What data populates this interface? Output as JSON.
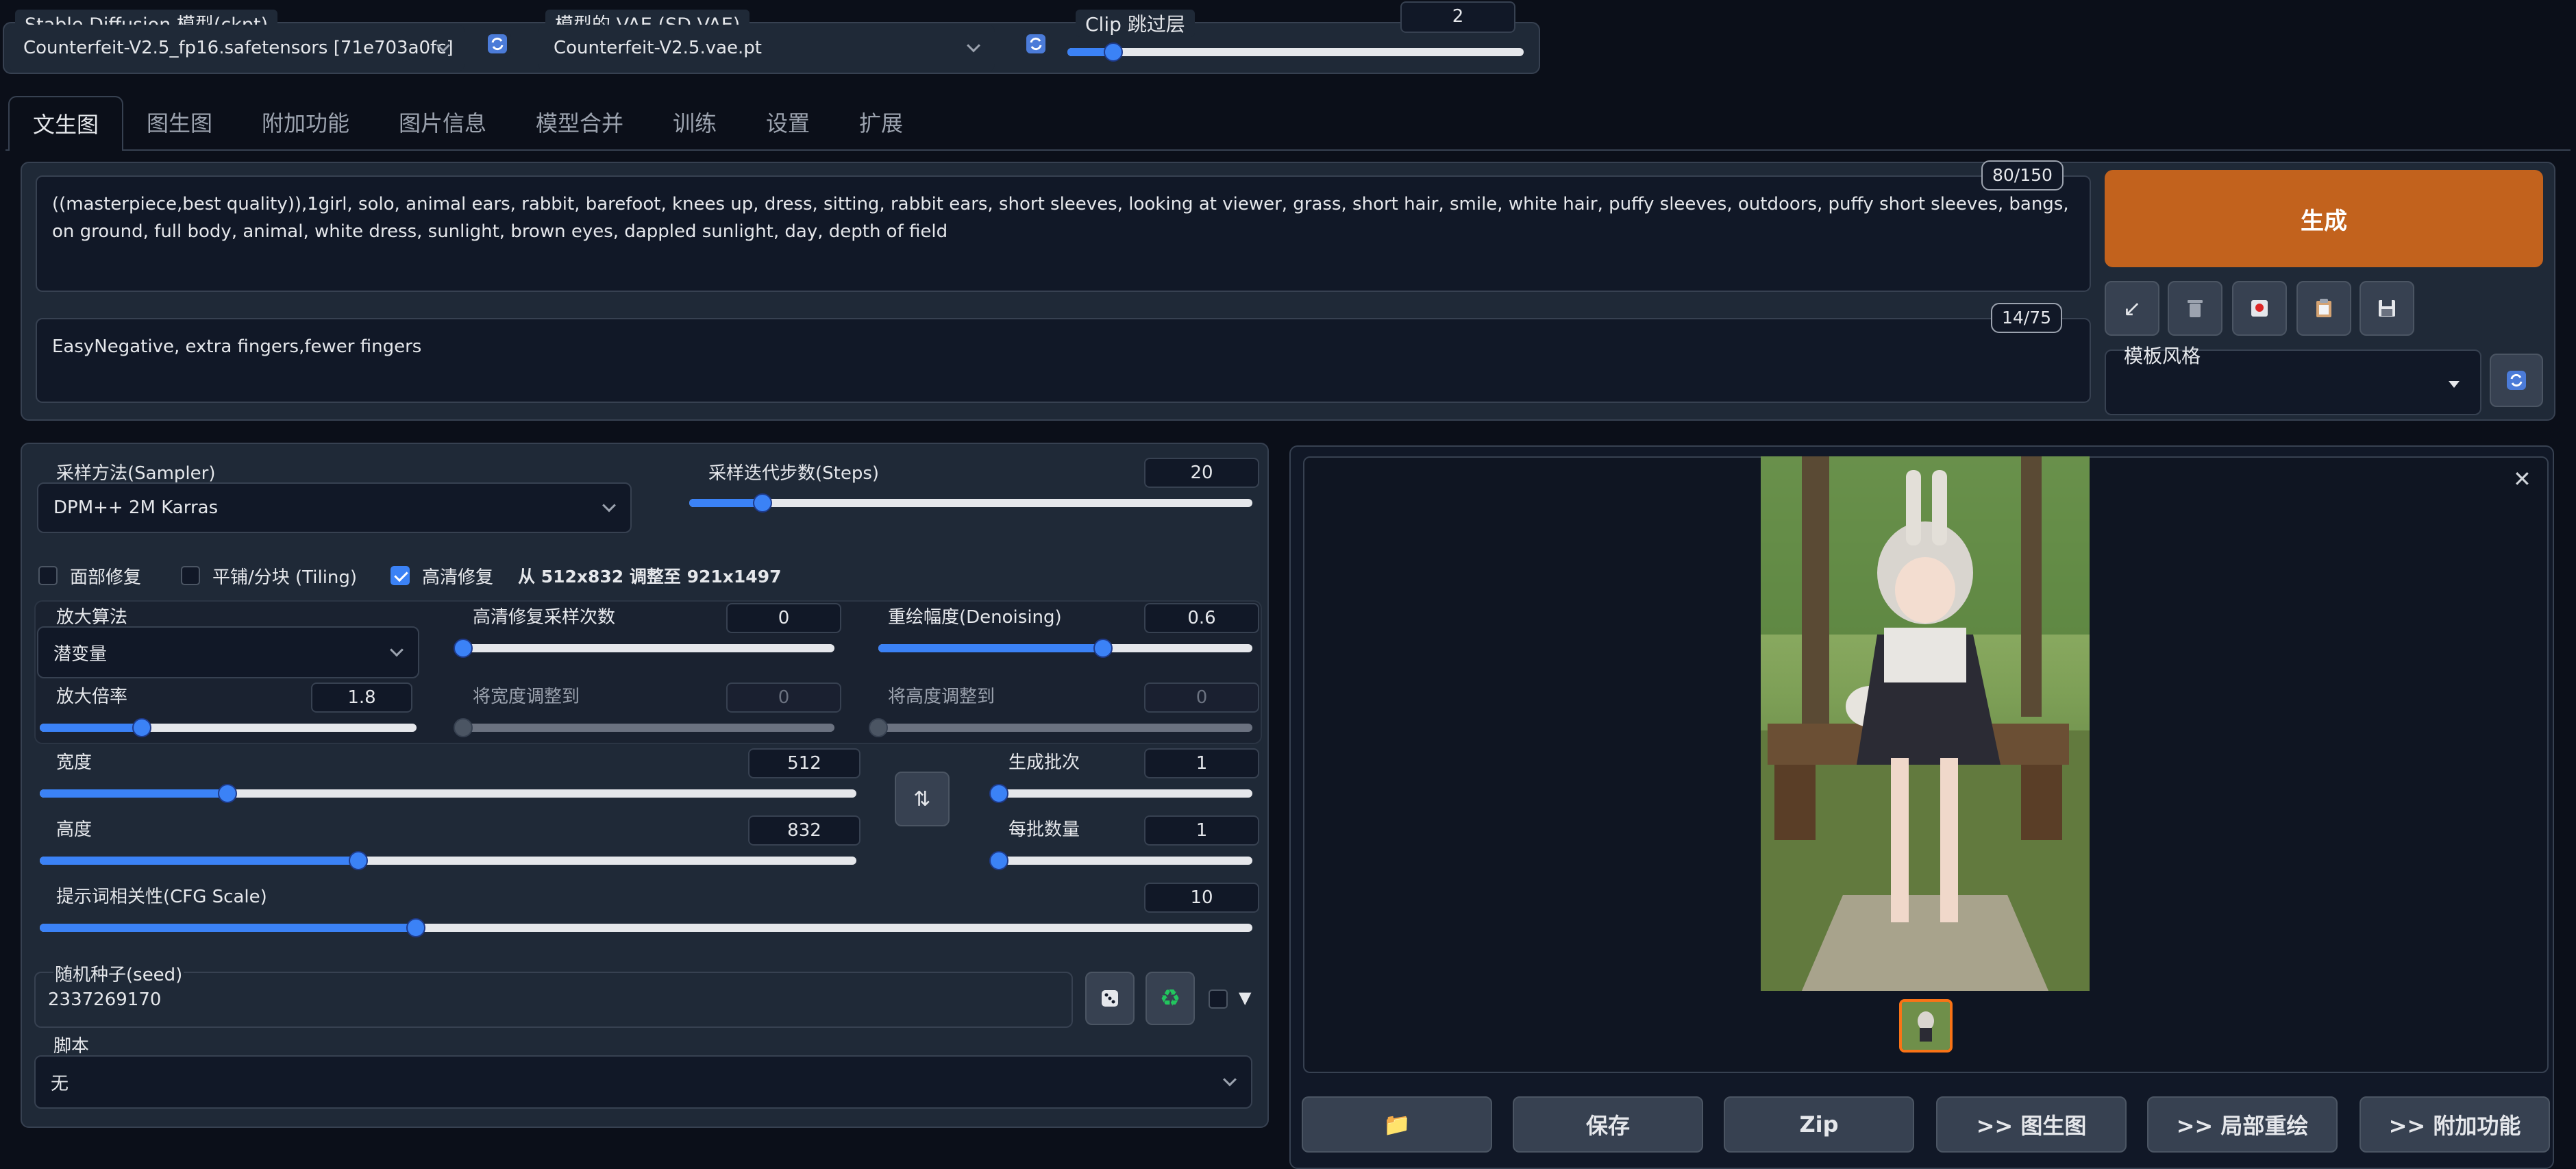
{
  "top": {
    "ckpt_label": "Stable Diffusion 模型(ckpt)",
    "ckpt_value": "Counterfeit-V2.5_fp16.safetensors [71e703a0fc]",
    "vae_label": "模型的 VAE (SD VAE)",
    "vae_value": "Counterfeit-V2.5.vae.pt",
    "clip_label": "Clip 跳过层",
    "clip_value": "2",
    "clip_level": 0.1
  },
  "tabs": [
    "文生图",
    "图生图",
    "附加功能",
    "图片信息",
    "模型合并",
    "训练",
    "设置",
    "扩展"
  ],
  "prompt": {
    "positive": "((masterpiece,best quality)),1girl, solo, animal ears, rabbit, barefoot, knees up, dress, sitting, rabbit ears, short sleeves, looking at viewer, grass, short hair, smile, white hair, puffy sleeves, outdoors, puffy short sleeves, bangs, on ground, full body, animal, white dress, sunlight, brown eyes, dappled sunlight, day, depth of field",
    "positive_count": "80/150",
    "negative": "EasyNegative, extra fingers,fewer fingers",
    "negative_count": "14/75"
  },
  "generate": {
    "button": "生成",
    "style_label": "模板风格"
  },
  "settings": {
    "sampler_label": "采样方法(Sampler)",
    "sampler_value": "DPM++ 2M Karras",
    "steps_label": "采样迭代步数(Steps)",
    "steps_value": "20",
    "steps_level": 0.13,
    "face_restore": "面部修复",
    "tiling": "平铺/分块 (Tiling)",
    "hires": "高清修复",
    "hires_info": "从 512x832 调整至 921x1497",
    "upscaler_label": "放大算法",
    "upscaler_value": "潜变量",
    "hires_steps_label": "高清修复采样次数",
    "hires_steps_value": "0",
    "hires_steps_level": 0.0,
    "denoise_label": "重绘幅度(Denoising)",
    "denoise_value": "0.6",
    "denoise_level": 0.6,
    "scale_label": "放大倍率",
    "scale_value": "1.8",
    "scale_level": 0.27,
    "resize_w_label": "将宽度调整到",
    "resize_w_value": "0",
    "resize_h_label": "将高度调整到",
    "resize_h_value": "0",
    "width_label": "宽度",
    "width_value": "512",
    "width_level": 0.23,
    "height_label": "高度",
    "height_value": "832",
    "height_level": 0.39,
    "batch_count_label": "生成批次",
    "batch_count_value": "1",
    "batch_count_level": 0.0,
    "batch_size_label": "每批数量",
    "batch_size_value": "1",
    "batch_size_level": 0.0,
    "cfg_label": "提示词相关性(CFG Scale)",
    "cfg_value": "10",
    "cfg_level": 0.31,
    "seed_label": "随机种子(seed)",
    "seed_value": "2337269170",
    "script_label": "脚本",
    "script_value": "无"
  },
  "output": {
    "buttons": [
      "📁",
      "保存",
      "Zip",
      ">> 图生图",
      ">> 局部重绘",
      ">> 附加功能"
    ]
  },
  "colors": {
    "accent": "#3b82f6",
    "generate": "#c2621d",
    "background": "#0b0f19",
    "panel": "#1f2937"
  }
}
